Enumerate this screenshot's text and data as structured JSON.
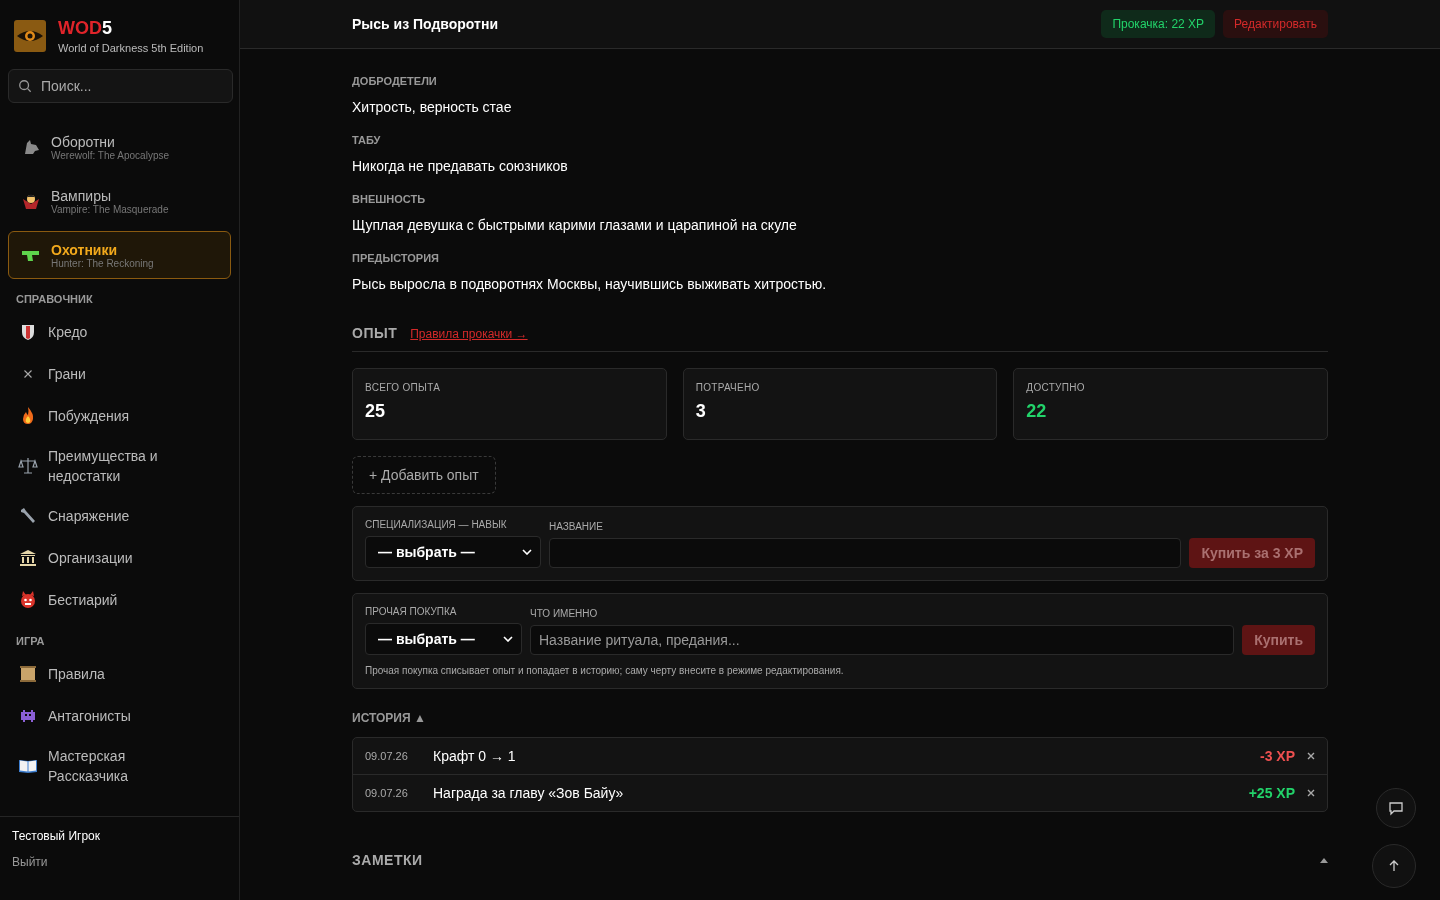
{
  "brand": {
    "logo_red": "WOD",
    "logo_white": "5",
    "subtitle": "World of Darkness 5th Edition"
  },
  "search": {
    "placeholder": "Поиск..."
  },
  "games": [
    {
      "title": "Оборотни",
      "subtitle": "Werewolf: The Apocalypse",
      "selected": false
    },
    {
      "title": "Вампиры",
      "subtitle": "Vampire: The Masquerade",
      "selected": false
    },
    {
      "title": "Охотники",
      "subtitle": "Hunter: The Reckoning",
      "selected": true
    }
  ],
  "nav_sections": [
    {
      "title": "СПРАВОЧНИК",
      "items": [
        "Кредо",
        "Грани",
        "Побуждения",
        "Преимущества и недостатки",
        "Снаряжение",
        "Организации",
        "Бестиарий"
      ]
    },
    {
      "title": "ИГРА",
      "items": [
        "Правила",
        "Антагонисты",
        "Мастерская Рассказчика"
      ]
    }
  ],
  "user": {
    "name": "Тестовый Игрок",
    "logout": "Выйти"
  },
  "header": {
    "title": "Рысь из Подворотни",
    "xp_badge": "Прокачка: 22 XP",
    "edit": "Редактировать"
  },
  "fields": [
    {
      "label": "ДОБРОДЕТЕЛИ",
      "value": "Хитрость, верность стае"
    },
    {
      "label": "ТАБУ",
      "value": "Никогда не предавать союзников"
    },
    {
      "label": "ВНЕШНОСТЬ",
      "value": "Щуплая девушка с быстрыми карими глазами и царапиной на скуле"
    },
    {
      "label": "ПРЕДЫСТОРИЯ",
      "value": "Рысь выросла в подворотнях Москвы, научившись выживать хитростью."
    }
  ],
  "xp": {
    "title": "ОПЫТ",
    "rules_link": "Правила прокачки →",
    "stats": [
      {
        "label": "ВСЕГО ОПЫТА",
        "value": "25",
        "kind": "plain"
      },
      {
        "label": "ПОТРАЧЕНО",
        "value": "3",
        "kind": "plain"
      },
      {
        "label": "ДОСТУПНО",
        "value": "22",
        "kind": "positive"
      }
    ],
    "add_button": "+ Добавить опыт"
  },
  "spec_purchase": {
    "select_label": "СПЕЦИАЛИЗАЦИЯ — НАВЫК",
    "select_value": "— выбрать —",
    "name_label": "НАЗВАНИЕ",
    "button": "Купить за 3 XP"
  },
  "other_purchase": {
    "select_label": "ПРОЧАЯ ПОКУПКА",
    "select_value": "— выбрать —",
    "what_label": "ЧТО ИМЕННО",
    "placeholder": "Название ритуала, предания...",
    "button": "Купить",
    "note": "Прочая покупка списывает опыт и попадает в историю; саму черту внесите в режиме редактирования."
  },
  "history": {
    "title": "ИСТОРИЯ ▲",
    "rows": [
      {
        "date": "09.07.26",
        "text": "Крафт 0 → 1",
        "amount": "-3 XP",
        "kind": "spend"
      },
      {
        "date": "09.07.26",
        "text": "Награда за главу «Зов Байу»",
        "amount": "+25 XP",
        "kind": "gain"
      }
    ]
  },
  "notes": {
    "title": "ЗАМЕТКИ"
  }
}
